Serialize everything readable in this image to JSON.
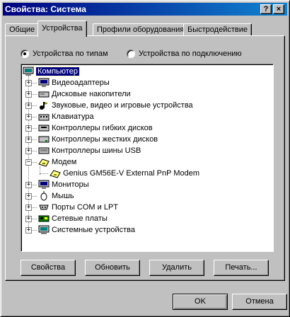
{
  "window": {
    "title": "Свойства: Система",
    "help_btn": "?",
    "close_btn": "×"
  },
  "tabs": [
    {
      "label": "Общие"
    },
    {
      "label": "Устройства"
    },
    {
      "label": "Профили оборудования"
    },
    {
      "label": "Быстродействие"
    }
  ],
  "view": {
    "by_type": "Устройства по типам",
    "by_connection": "Устройства по подключению",
    "selected": "by_type"
  },
  "tree": {
    "root": "Компьютер",
    "items": [
      {
        "label": "Видеоадаптеры",
        "icon": "monitor-icon",
        "expanded": false
      },
      {
        "label": "Дисковые накопители",
        "icon": "disk-drive-icon",
        "expanded": false
      },
      {
        "label": "Звуковые, видео и игровые устройства",
        "icon": "sound-icon",
        "expanded": false
      },
      {
        "label": "Клавиатура",
        "icon": "keyboard-icon",
        "expanded": false
      },
      {
        "label": "Контроллеры гибких дисков",
        "icon": "floppy-controller-icon",
        "expanded": false
      },
      {
        "label": "Контроллеры жестких дисков",
        "icon": "hdd-controller-icon",
        "expanded": false
      },
      {
        "label": "Контроллеры шины USB",
        "icon": "usb-icon",
        "expanded": false
      },
      {
        "label": "Модем",
        "icon": "modem-icon",
        "expanded": true
      },
      {
        "label": "Genius GM56E-V External PnP Modem",
        "icon": "modem-icon",
        "child": true
      },
      {
        "label": "Мониторы",
        "icon": "monitor-icon",
        "expanded": false
      },
      {
        "label": "Мышь",
        "icon": "mouse-icon",
        "expanded": false
      },
      {
        "label": "Порты COM и LPT",
        "icon": "port-icon",
        "expanded": false
      },
      {
        "label": "Сетевые платы",
        "icon": "network-card-icon",
        "expanded": false
      },
      {
        "label": "Системные устройства",
        "icon": "system-device-icon",
        "expanded": false
      }
    ]
  },
  "actions": {
    "properties": "Свойства",
    "refresh": "Обновить",
    "remove": "Удалить",
    "print": "Печать..."
  },
  "dialog": {
    "ok": "OK",
    "cancel": "Отмена"
  },
  "colors": {
    "title_start": "#000080",
    "title_end": "#1084d0",
    "face": "#c0c0c0",
    "selection": "#000080"
  }
}
